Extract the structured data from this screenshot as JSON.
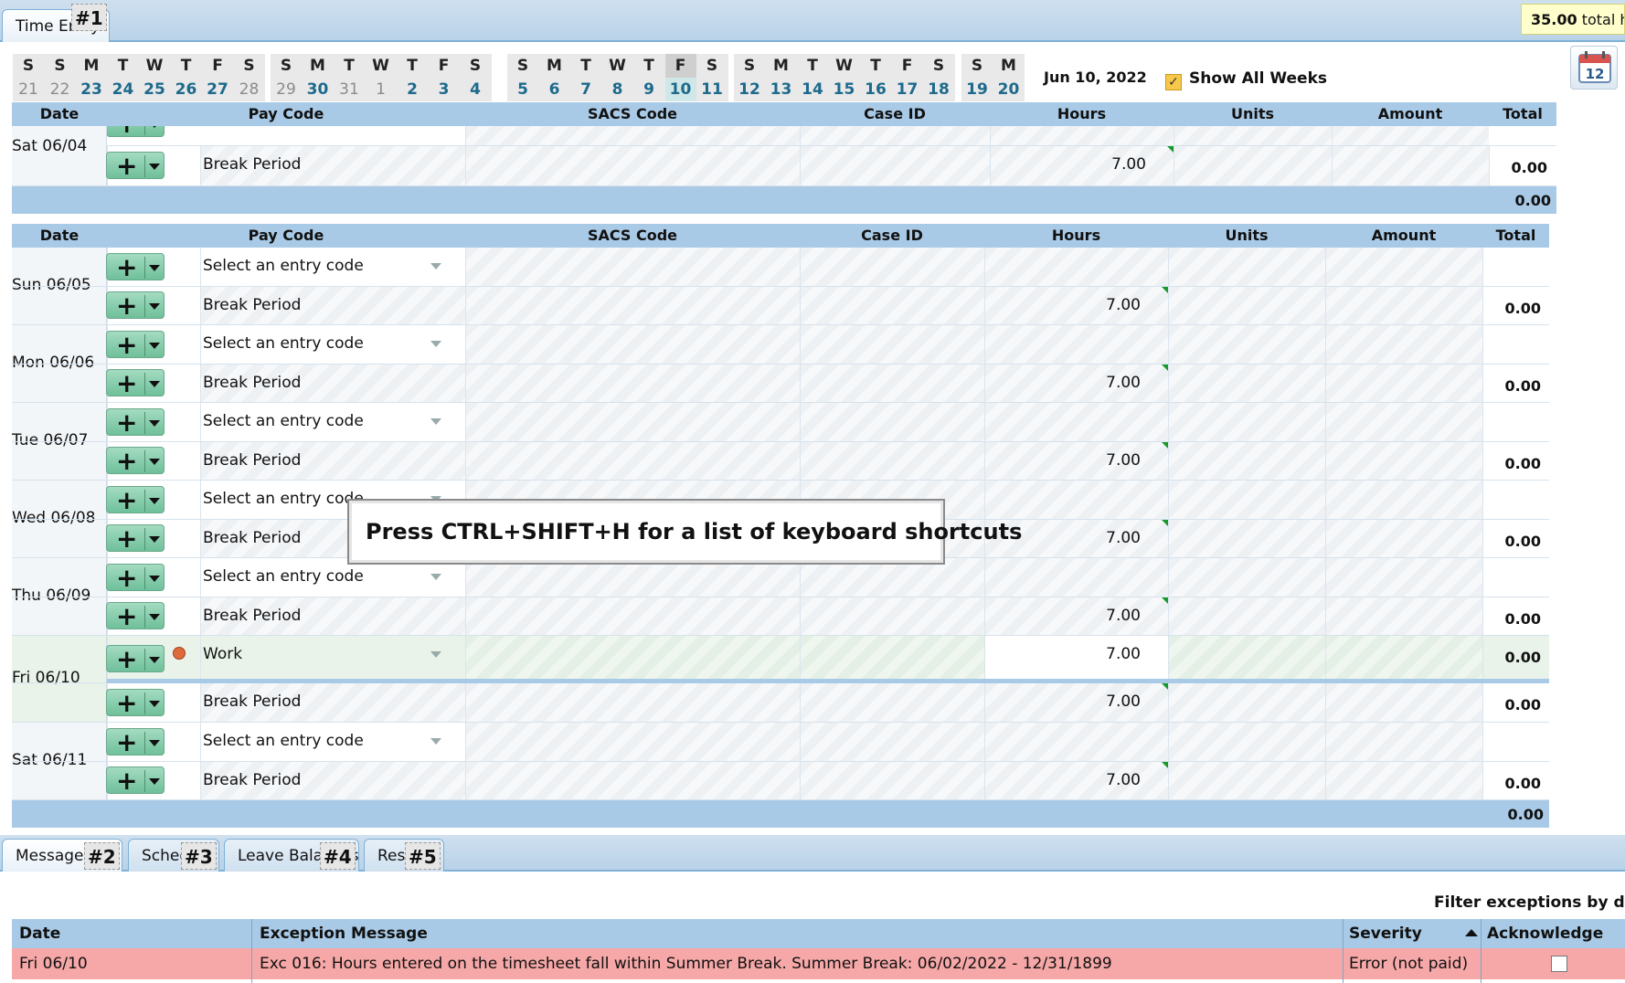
{
  "tabs_top": [
    {
      "label": "Time Entry",
      "hint": "#1"
    }
  ],
  "total_hours": {
    "value": "35.00",
    "text": "total hours"
  },
  "calendar": {
    "weeks": [
      {
        "letters": [
          "S",
          "S",
          "M",
          "T",
          "W",
          "T",
          "F",
          "S"
        ],
        "nums": [
          "21",
          "22",
          "23",
          "24",
          "25",
          "26",
          "27",
          "28"
        ]
      },
      {
        "letters": [
          "S",
          "M",
          "T",
          "W",
          "T",
          "F",
          "S"
        ],
        "nums": [
          "29",
          "30",
          "31",
          "1",
          "2",
          "3",
          "4"
        ]
      },
      {
        "letters": [
          "S",
          "M",
          "T",
          "W",
          "T",
          "F",
          "S"
        ],
        "nums": [
          "5",
          "6",
          "7",
          "8",
          "9",
          "10",
          "11"
        ]
      },
      {
        "letters": [
          "S",
          "M",
          "T",
          "W",
          "T",
          "F",
          "S"
        ],
        "nums": [
          "12",
          "13",
          "14",
          "15",
          "16",
          "17",
          "18"
        ]
      },
      {
        "letters": [
          "S",
          "M"
        ],
        "nums": [
          "19",
          "20"
        ]
      }
    ],
    "date_label": "Jun 10, 2022",
    "show_all_weeks": "Show All Weeks",
    "calendar_icon": "calendar-icon"
  },
  "columns": [
    "Date",
    "Pay Code",
    "SACS Code",
    "Case ID",
    "Hours",
    "Units",
    "Amount",
    "Total"
  ],
  "week1": {
    "rows": [
      {
        "date": "Sat 06/04",
        "pay": "Break Period",
        "hours": "7.00",
        "total": "0.00"
      }
    ],
    "week_total": "0.00"
  },
  "week2": {
    "days": [
      {
        "date": "Sun 06/05",
        "entries": [
          {
            "pay": "Select an entry code",
            "hours": "",
            "total": ""
          },
          {
            "pay": "Break Period",
            "hours": "7.00",
            "total": "0.00"
          }
        ]
      },
      {
        "date": "Mon 06/06",
        "entries": [
          {
            "pay": "Select an entry code",
            "hours": "",
            "total": ""
          },
          {
            "pay": "Break Period",
            "hours": "7.00",
            "total": "0.00"
          }
        ]
      },
      {
        "date": "Tue 06/07",
        "entries": [
          {
            "pay": "Select an entry code",
            "hours": "",
            "total": ""
          },
          {
            "pay": "Break Period",
            "hours": "7.00",
            "total": "0.00"
          }
        ]
      },
      {
        "date": "Wed 06/08",
        "entries": [
          {
            "pay": "Select an entry code",
            "hours": "",
            "total": ""
          },
          {
            "pay": "Break Period",
            "hours": "7.00",
            "total": "0.00"
          }
        ]
      },
      {
        "date": "Thu 06/09",
        "entries": [
          {
            "pay": "Select an entry code",
            "hours": "",
            "total": ""
          },
          {
            "pay": "Break Period",
            "hours": "7.00",
            "total": "0.00"
          }
        ]
      },
      {
        "date": "Fri 06/10",
        "entries": [
          {
            "pay": "Work",
            "hours": "7.00",
            "total": "0.00"
          },
          {
            "pay": "Break Period",
            "hours": "7.00",
            "total": "0.00"
          }
        ]
      },
      {
        "date": "Sat 06/11",
        "entries": [
          {
            "pay": "Select an entry code",
            "hours": "",
            "total": ""
          },
          {
            "pay": "Break Period",
            "hours": "7.00",
            "total": "0.00"
          }
        ]
      }
    ],
    "week_total": "0.00"
  },
  "tooltip": "Press CTRL+SHIFT+H for a list of keyboard shortcuts",
  "tabs_bottom": [
    {
      "label": "Messages",
      "hint": "#2"
    },
    {
      "label": "Schedule",
      "hint": "#3"
    },
    {
      "label": "Leave Balances",
      "hint": "#4"
    },
    {
      "label": "Results",
      "hint": "#5"
    }
  ],
  "filter_label": "Filter exceptions by day",
  "exceptions": {
    "headers": [
      "Date",
      "Exception Message",
      "Severity",
      "Acknowledge"
    ],
    "rows": [
      {
        "date": "Fri 06/10",
        "message": "Exc 016: Hours entered on the timesheet fall within Summer Break. Summer Break: 06/02/2022 - 12/31/1899",
        "severity": "Error (not paid)"
      }
    ]
  },
  "colors": {
    "header_blue": "#a9cae6",
    "link_teal": "#1d6a8d",
    "error_row": "#f6a7a7",
    "add_green": "#6fc09b",
    "check_yellow": "#f8c84a"
  }
}
